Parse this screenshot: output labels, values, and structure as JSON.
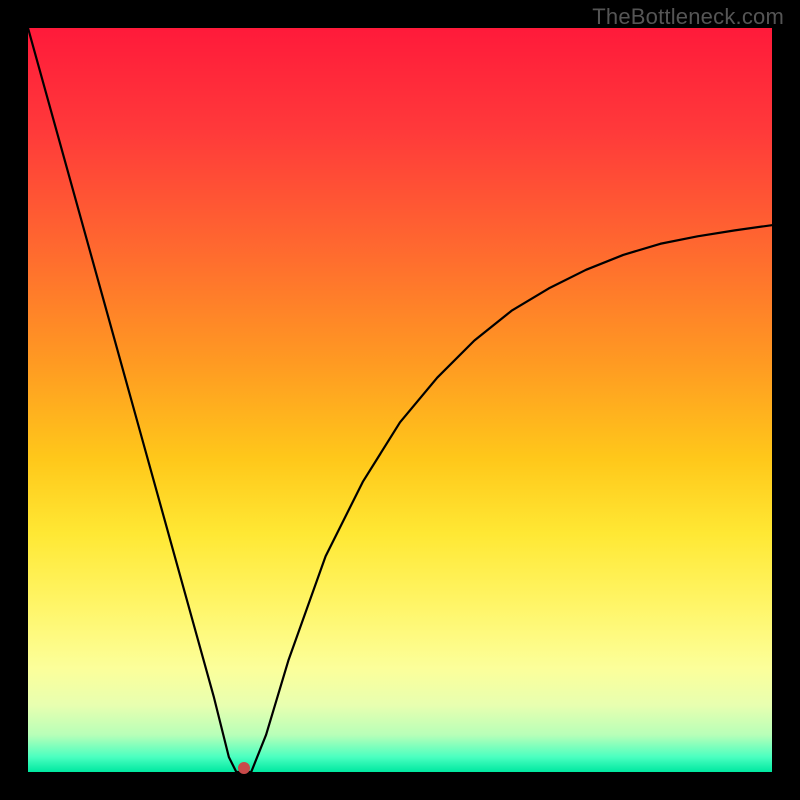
{
  "watermark": "TheBottleneck.com",
  "chart_data": {
    "type": "line",
    "title": "",
    "xlabel": "",
    "ylabel": "",
    "xlim": [
      0,
      100
    ],
    "ylim": [
      0,
      100
    ],
    "series": [
      {
        "name": "bottleneck-curve",
        "x": [
          0,
          5,
          10,
          15,
          20,
          25,
          27,
          28,
          30,
          32,
          35,
          40,
          45,
          50,
          55,
          60,
          65,
          70,
          75,
          80,
          85,
          90,
          95,
          100
        ],
        "values": [
          100,
          82,
          64,
          46,
          28,
          10,
          2,
          0,
          0,
          5,
          15,
          29,
          39,
          47,
          53,
          58,
          62,
          65,
          67.5,
          69.5,
          71,
          72,
          72.8,
          73.5
        ]
      }
    ],
    "marker": {
      "x": 29,
      "y": 0.5,
      "color": "#c94a4a"
    },
    "background_gradient": {
      "top": "#ff1a3a",
      "mid": "#ffe834",
      "bottom": "#00e8a0"
    }
  }
}
